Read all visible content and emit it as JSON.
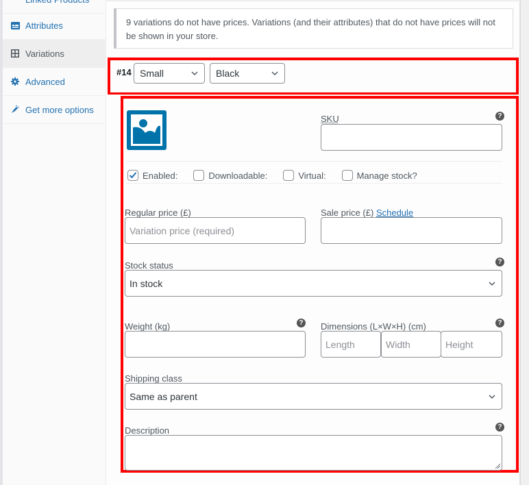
{
  "sidebar": {
    "items": [
      {
        "label": "Linked Products",
        "icon": "link-icon"
      },
      {
        "label": "Attributes",
        "icon": "attributes-icon"
      },
      {
        "label": "Variations",
        "icon": "grid-icon",
        "active": true
      },
      {
        "label": "Advanced",
        "icon": "gear-icon"
      },
      {
        "label": "Get more options",
        "icon": "plugin-icon"
      }
    ]
  },
  "notice": {
    "text": "9 variations do not have prices. Variations (and their attributes) that do not have prices will not be shown in your store."
  },
  "variation": {
    "number": "#14",
    "attribute_size": "Small",
    "attribute_color": "Black",
    "sku_label": "SKU",
    "sku_value": "",
    "checkboxes": {
      "enabled": {
        "label": "Enabled:",
        "checked": true
      },
      "downloadable": {
        "label": "Downloadable:",
        "checked": false
      },
      "virtual": {
        "label": "Virtual:",
        "checked": false
      },
      "manage_stock": {
        "label": "Manage stock?",
        "checked": false
      }
    },
    "regular_price_label": "Regular price (£)",
    "regular_price_placeholder": "Variation price (required)",
    "sale_price_label": "Sale price (£)",
    "schedule_link": "Schedule",
    "stock_status_label": "Stock status",
    "stock_status_value": "In stock",
    "weight_label": "Weight (kg)",
    "dimensions_label": "Dimensions (L×W×H) (cm)",
    "length_placeholder": "Length",
    "width_placeholder": "Width",
    "height_placeholder": "Height",
    "shipping_class_label": "Shipping class",
    "shipping_class_value": "Same as parent",
    "description_label": "Description",
    "help_glyph": "?"
  },
  "colors": {
    "accent": "#2271b1",
    "highlight_border": "#ff0000",
    "image_placeholder": "#0073aa"
  }
}
